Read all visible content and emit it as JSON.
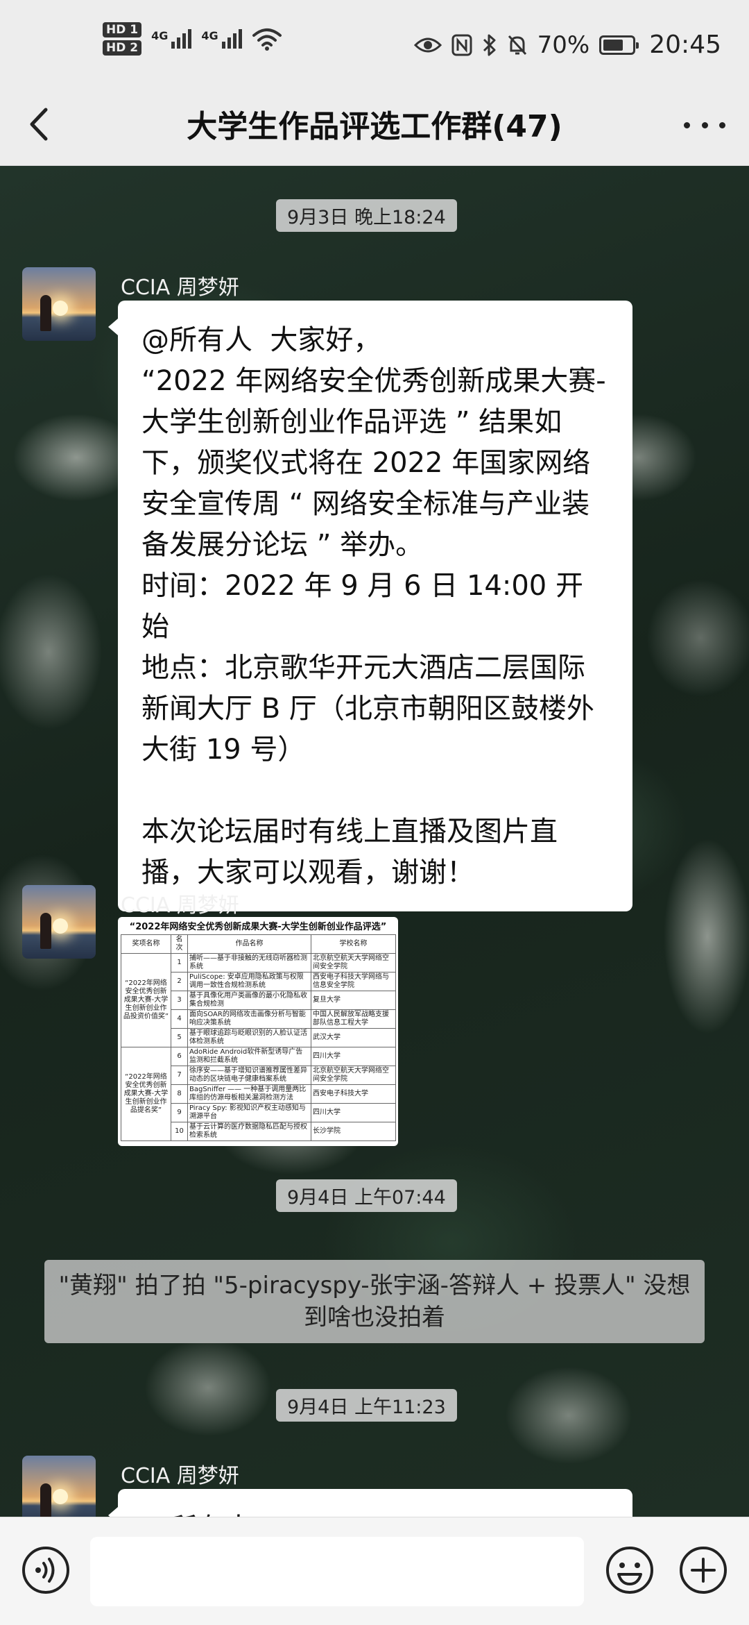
{
  "status_bar": {
    "hd_badges": [
      "HD 1",
      "HD 2"
    ],
    "signal_labels": [
      "4G",
      "4G"
    ],
    "battery": "70%",
    "battery_level": 0.7,
    "time": "20:45",
    "icons": [
      "eye-icon",
      "nfc-icon",
      "bluetooth-icon",
      "mute-icon",
      "battery-icon",
      "wifi-icon",
      "signal-icon"
    ]
  },
  "header": {
    "title": "大学生作品评选工作群(47)",
    "icons": [
      "back-arrow-icon",
      "more-icon"
    ]
  },
  "chat": {
    "timestamps": [
      "9月3日 晚上18:24",
      "9月4日 上午07:44",
      "9月4日 上午11:23"
    ],
    "messages": [
      {
        "sender": "CCIA 周梦妍",
        "text": "@所有人  大家好，\n“2022 年网络安全优秀创新成果大赛-大学生创新创业作品评选 ” 结果如下，颁奖仪式将在 2022 年国家网络安全宣传周 “ 网络安全标准与产业装备发展分论坛 ” 举办。\n时间：2022 年 9 月 6 日 14:00 开始\n地点：北京歌华开元大酒店二层国际新闻大厅 B 厅（北京市朝阳区鼓楼外大街 19 号）\n\n本次论坛届时有线上直播及图片直播，大家可以观看，谢谢！"
      },
      {
        "sender": "CCIA 周梦妍",
        "image": {
          "title": "“2022年网络安全优秀创新成果大赛-大学生创新创业作品评选”",
          "headers": [
            "奖项名称",
            "名次",
            "作品名称",
            "学校名称"
          ],
          "group_labels": [
            "“2022年网络安全优秀创新成果大赛-大学生创新创业作品投资价值奖”",
            "“2022年网络安全优秀创新成果大赛-大学生创新创业作品提名奖”"
          ],
          "rows": [
            {
              "rank": "1",
              "work": "捕听——基于非接触的无线窃听器检测系统",
              "school": "北京航空航天大学网络空间安全学院"
            },
            {
              "rank": "2",
              "work": "PuliScope: 安卓应用隐私政策与权限调用一致性合规检测系统",
              "school": "西安电子科技大学网络与信息安全学院"
            },
            {
              "rank": "3",
              "work": "基于具像化用户类画像的最小化隐私收集合规检测",
              "school": "复旦大学"
            },
            {
              "rank": "4",
              "work": "面向SOAR的网络攻击画像分析与智能响应决策系统",
              "school": "中国人民解放军战略支援部队信息工程大学"
            },
            {
              "rank": "5",
              "work": "基于眼球追踪与眨眼识别的人脸认证活体检测系统",
              "school": "武汉大学"
            },
            {
              "rank": "6",
              "work": "AdoRide Android软件新型诱导广告监测和拦截系统",
              "school": "四川大学"
            },
            {
              "rank": "7",
              "work": "徐序安——基于增知识谱推荐属性差异动态的区块链电子健康档案系统",
              "school": "北京航空航天大学网络空间安全学院"
            },
            {
              "rank": "8",
              "work": "BagSniffer —— 一种基于调用量两比库组的仿源母板相关漏洞检测方法",
              "school": "西安电子科技大学"
            },
            {
              "rank": "9",
              "work": "Piracy Spy: 影视知识产权主动感知与溯源平台",
              "school": "四川大学"
            },
            {
              "rank": "10",
              "work": "基于云计算的医疗数据隐私匹配与授权检索系统",
              "school": "长沙学院"
            }
          ]
        }
      },
      {
        "sender": "CCIA 周梦妍",
        "text": "@所有人"
      }
    ],
    "system_message": "\"黄翔\" 拍了拍 \"5-piracyspy-张宇涵-答辩人 + 投票人\" 没想到啥也没拍着"
  },
  "input_bar": {
    "icons": [
      "voice-icon",
      "emoji-icon",
      "plus-icon"
    ],
    "value": ""
  }
}
